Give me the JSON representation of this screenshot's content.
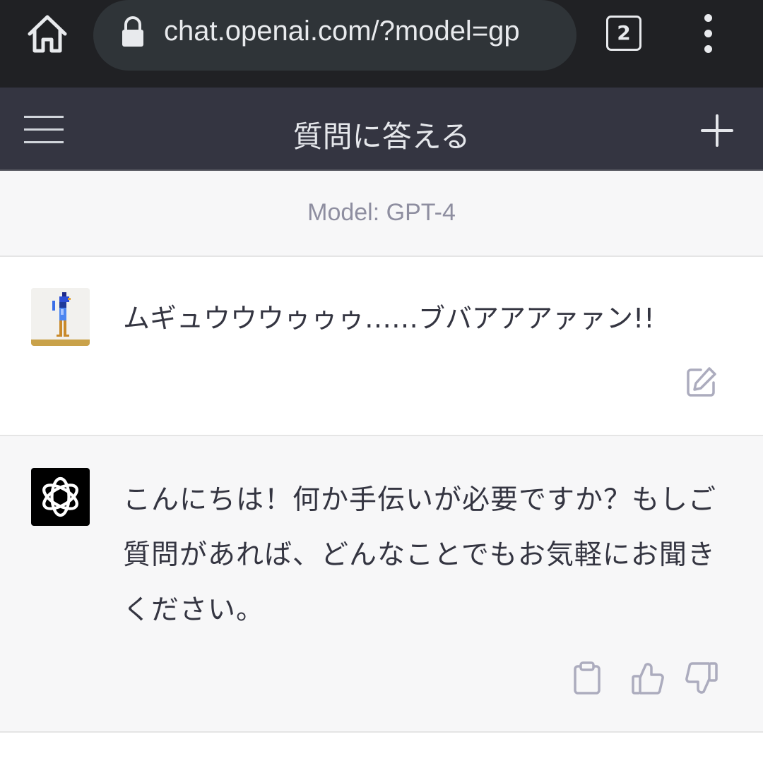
{
  "browser": {
    "url": "chat.openai.com/?model=gp",
    "tab_count": "2",
    "icons": [
      "home-icon",
      "lock-icon",
      "tabs-icon",
      "more-vert-icon"
    ]
  },
  "header": {
    "title": "質問に答える",
    "icons": [
      "menu-icon",
      "plus-icon"
    ]
  },
  "model_label": "Model: GPT-4",
  "messages": {
    "user": {
      "text": "ムギュウウウゥゥゥ……ブバアアアァァン!!",
      "icons": [
        "pixel-bird-avatar",
        "edit-icon"
      ]
    },
    "assistant": {
      "text": "こんにちは！何か手伝いが必要ですか？もしご質問があれば、どんなことでもお気軽にお聞きください。",
      "icons": [
        "openai-logo-icon",
        "clipboard-icon",
        "thumbs-up-icon",
        "thumbs-down-icon"
      ]
    }
  },
  "colors": {
    "browser_bg": "#202124",
    "header_bg": "#343541",
    "assistant_bg": "#f7f7f8",
    "muted_icon": "#acacbe"
  }
}
